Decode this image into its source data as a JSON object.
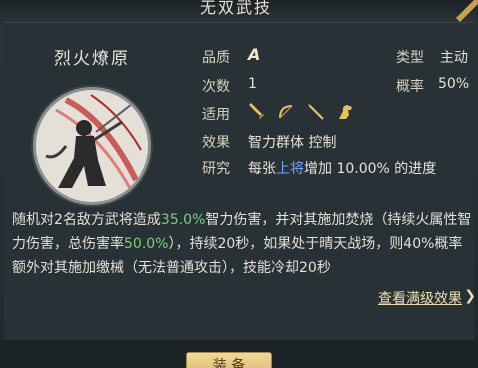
{
  "header": {
    "title": "无双武技"
  },
  "skill": {
    "name": "烈火燎原",
    "portrait_icon": "warrior-portrait-icon"
  },
  "attributes": {
    "grade_label": "品质",
    "grade_value": "A",
    "type_label": "类型",
    "type_value": "主动",
    "count_label": "次数",
    "count_value": "1",
    "rate_label": "概率",
    "rate_value": "50%",
    "apply_label": "适用",
    "apply_icons": [
      "sword-icon",
      "bow-icon",
      "spear-icon",
      "horse-icon"
    ],
    "effect_label": "效果",
    "effect_value": "智力群体 控制",
    "research_label": "研究",
    "research_prefix": "每张",
    "research_highlight": "上将",
    "research_suffix": "增加 10.00% 的进度"
  },
  "description": {
    "part1": "随机对2名敌方武将造成",
    "value1": "35.0%",
    "part2": "智力伤害，并对其施加焚烧（持续火属性智力伤害，总伤害率",
    "value2": "50.0%",
    "part3": "），持续20秒，如果处于晴天战场，则40%概率额外对其施加缴械（无法普通攻击），技能冷却20秒"
  },
  "links": {
    "view_full": "查看满级效果",
    "arrow": "❯"
  },
  "bottom_button": {
    "label": "装 备"
  },
  "colors": {
    "highlight_green": "#7ed07a",
    "highlight_blue": "#6ea8ff",
    "link_gold": "#f0dfae"
  }
}
